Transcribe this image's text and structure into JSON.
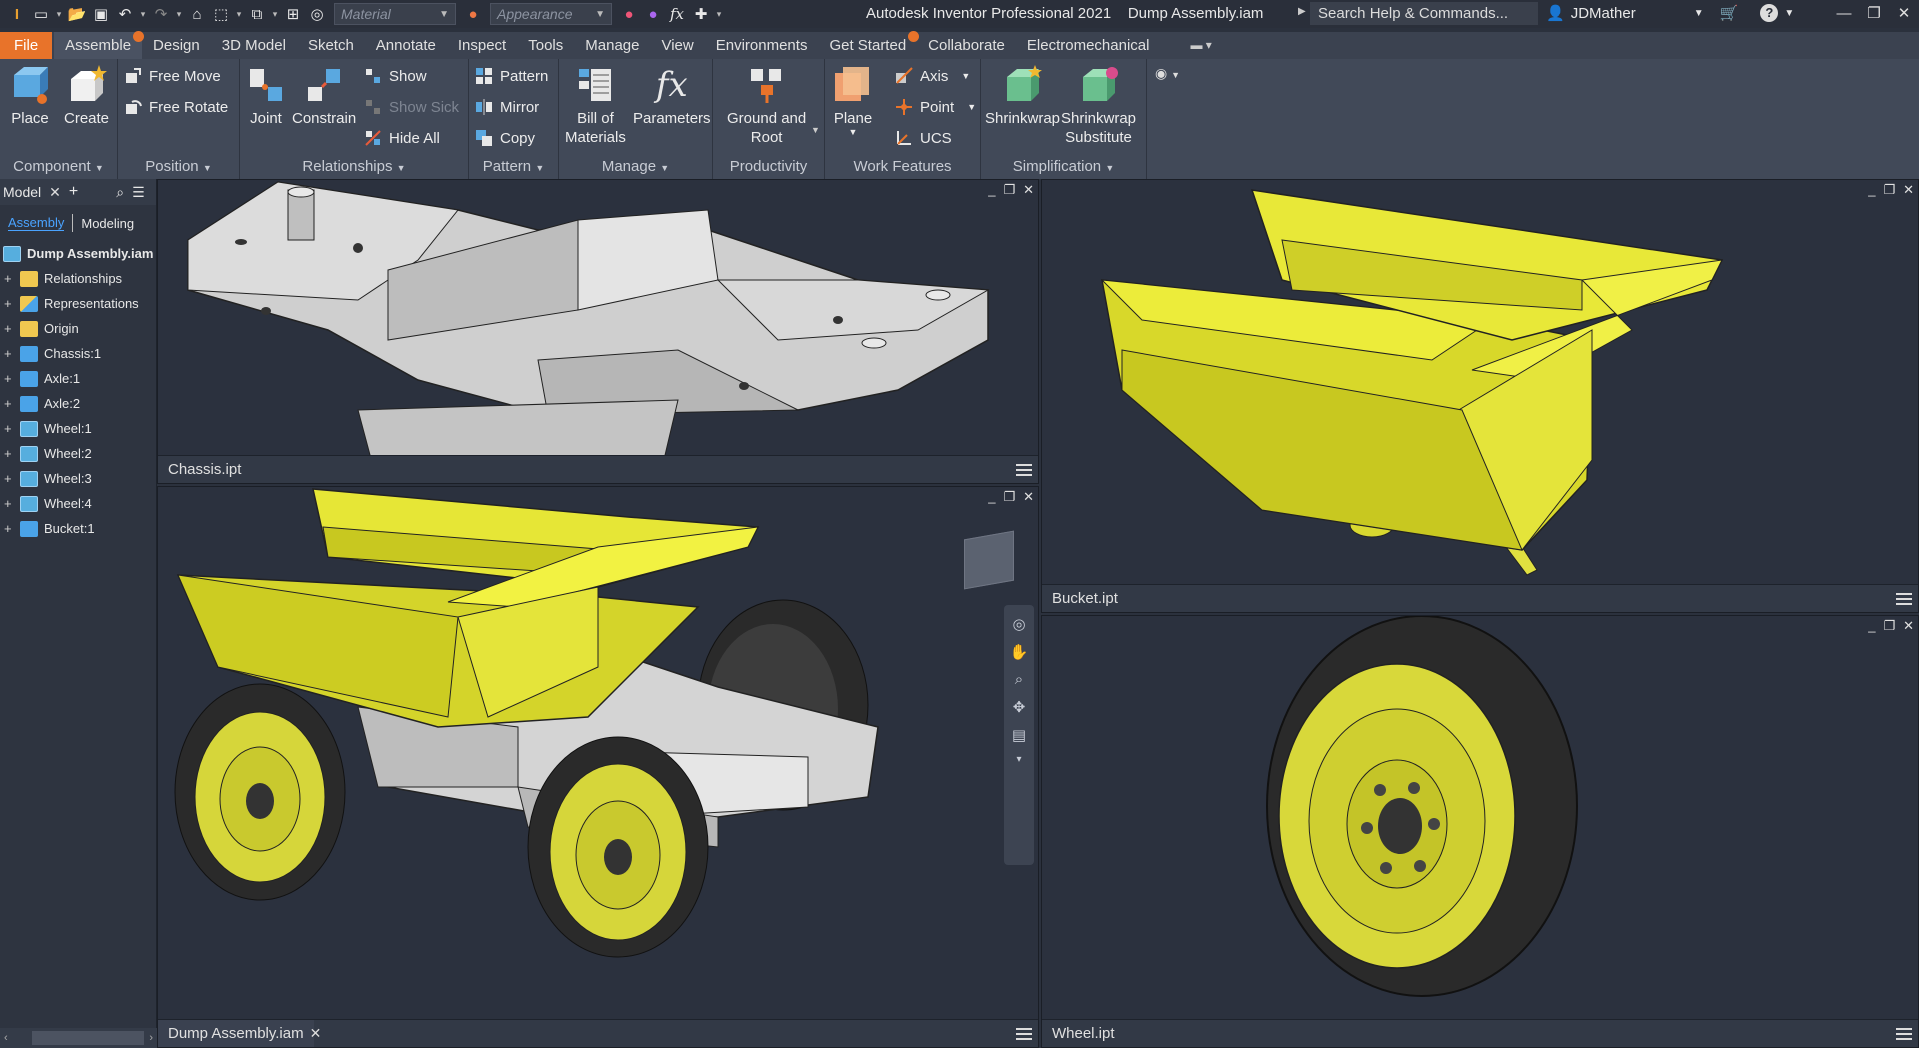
{
  "titlebar": {
    "material_placeholder": "Material",
    "appearance_placeholder": "Appearance",
    "app_name": "Autodesk Inventor Professional 2021",
    "document": "Dump Assembly.iam",
    "search_placeholder": "Search Help & Commands...",
    "user": "JDMather"
  },
  "tabs": [
    "File",
    "Assemble",
    "Design",
    "3D Model",
    "Sketch",
    "Annotate",
    "Inspect",
    "Tools",
    "Manage",
    "View",
    "Environments",
    "Get Started",
    "Collaborate",
    "Electromechanical"
  ],
  "ribbon": {
    "component": {
      "title": "Component",
      "place": "Place",
      "create": "Create"
    },
    "position": {
      "title": "Position",
      "free_move": "Free Move",
      "free_rotate": "Free Rotate"
    },
    "relationships": {
      "title": "Relationships",
      "joint": "Joint",
      "constrain": "Constrain",
      "show": "Show",
      "show_sick": "Show Sick",
      "hide_all": "Hide All"
    },
    "pattern": {
      "title": "Pattern",
      "pattern": "Pattern",
      "mirror": "Mirror",
      "copy": "Copy"
    },
    "manage": {
      "title": "Manage",
      "bom_1": "Bill of",
      "bom_2": "Materials",
      "parameters": "Parameters"
    },
    "productivity": {
      "title": "Productivity",
      "ground_1": "Ground and",
      "ground_2": "Root"
    },
    "work_features": {
      "title": "Work Features",
      "plane": "Plane",
      "axis": "Axis",
      "point": "Point",
      "ucs": "UCS"
    },
    "simplification": {
      "title": "Simplification",
      "shrinkwrap": "Shrinkwrap",
      "shrinkwrap_sub_1": "Shrinkwrap",
      "shrinkwrap_sub_2": "Substitute"
    }
  },
  "browser": {
    "title": "Model",
    "tab_assembly": "Assembly",
    "tab_modeling": "Modeling",
    "root": "Dump Assembly.iam",
    "items": [
      {
        "label": "Relationships",
        "icon": "folder-icon"
      },
      {
        "label": "Representations",
        "icon": "representations-icon"
      },
      {
        "label": "Origin",
        "icon": "folder-icon"
      },
      {
        "label": "Chassis:1",
        "icon": "part-icon"
      },
      {
        "label": "Axle:1",
        "icon": "part-icon"
      },
      {
        "label": "Axle:2",
        "icon": "part-icon"
      },
      {
        "label": "Wheel:1",
        "icon": "subassembly-icon"
      },
      {
        "label": "Wheel:2",
        "icon": "subassembly-icon"
      },
      {
        "label": "Wheel:3",
        "icon": "subassembly-icon"
      },
      {
        "label": "Wheel:4",
        "icon": "subassembly-icon"
      },
      {
        "label": "Bucket:1",
        "icon": "part-icon"
      }
    ]
  },
  "viewports": {
    "chassis": "Chassis.ipt",
    "bucket": "Bucket.ipt",
    "assembly": "Dump Assembly.iam",
    "wheel": "Wheel.ipt"
  },
  "colors": {
    "accent_orange": "#e8732a",
    "viewport_bg": "#2b313e",
    "bucket_yellow": "#e6e632",
    "chassis_gray": "#d4d4d4",
    "tire_black": "#2a2a2a",
    "selection_blue": "#4aa3ff"
  }
}
